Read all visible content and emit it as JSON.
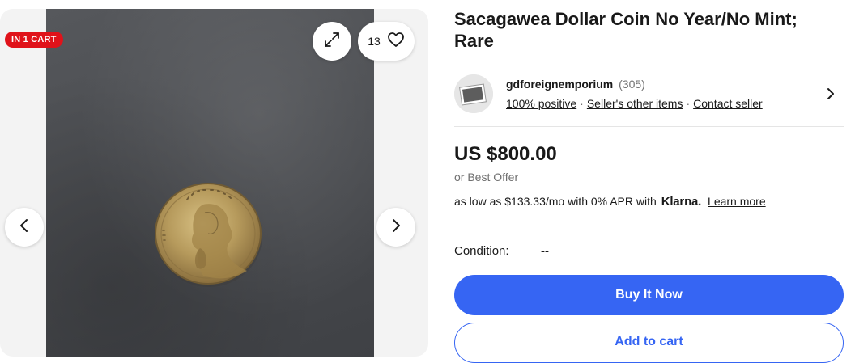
{
  "gallery": {
    "cart_badge": "IN 1 CART",
    "watch_count": "13",
    "icons": {
      "expand": "expand-icon",
      "heart": "heart-icon",
      "prev": "chevron-left-icon",
      "next": "chevron-right-icon"
    }
  },
  "listing": {
    "title": "Sacagawea Dollar Coin No Year/No Mint; Rare",
    "price": "US $800.00",
    "best_offer": "or Best Offer",
    "klarna": {
      "prefix": "as low as $133.33/mo with 0% APR with",
      "logo": "Klarna.",
      "learn_more": "Learn more"
    },
    "condition_label": "Condition:",
    "condition_value": "--"
  },
  "seller": {
    "name": "gdforeignemporium",
    "score": "(305)",
    "positive": "100% positive",
    "other_items": "Seller's other items",
    "contact": "Contact seller",
    "separator": "·"
  },
  "actions": {
    "buy_now": "Buy It Now",
    "add_to_cart": "Add to cart"
  },
  "colors": {
    "primary_blue": "#3665f3",
    "cart_badge_red": "#e0121a",
    "text": "#191919",
    "muted": "#707070"
  }
}
